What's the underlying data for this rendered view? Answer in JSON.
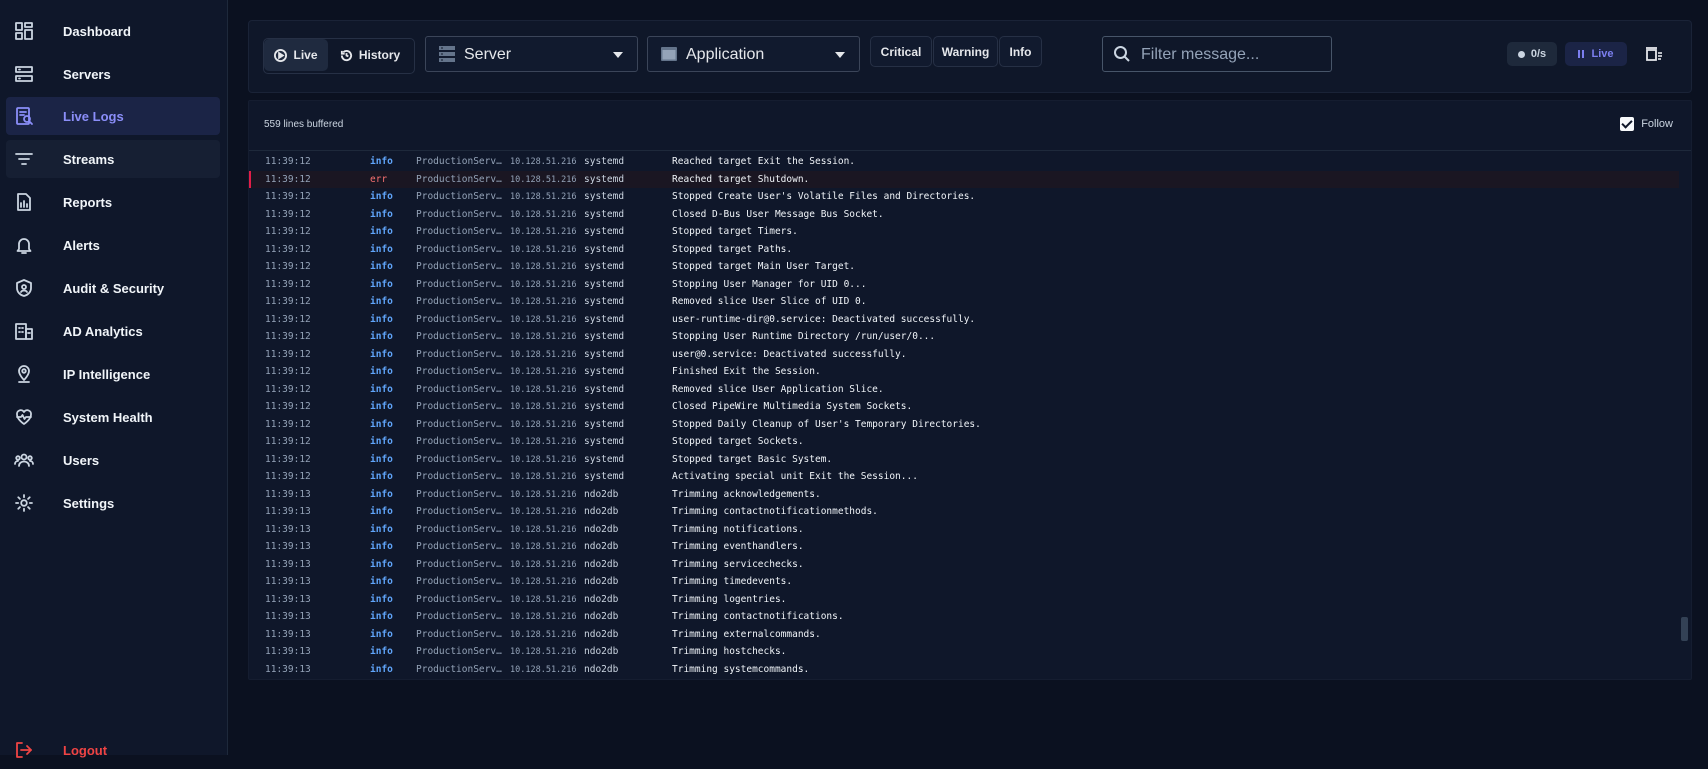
{
  "sidebar": {
    "items": [
      {
        "label": "Dashboard",
        "icon": "dashboard-icon"
      },
      {
        "label": "Servers",
        "icon": "server-icon"
      },
      {
        "label": "Live Logs",
        "icon": "live-logs-icon"
      },
      {
        "label": "Streams",
        "icon": "streams-icon"
      },
      {
        "label": "Reports",
        "icon": "reports-icon"
      },
      {
        "label": "Alerts",
        "icon": "bell-icon"
      },
      {
        "label": "Audit & Security",
        "icon": "shield-icon"
      },
      {
        "label": "AD Analytics",
        "icon": "building-icon"
      },
      {
        "label": "IP Intelligence",
        "icon": "map-pin-icon"
      },
      {
        "label": "System Health",
        "icon": "heartbeat-icon"
      },
      {
        "label": "Users",
        "icon": "users-icon"
      },
      {
        "label": "Settings",
        "icon": "gear-icon"
      }
    ],
    "active": "Live Logs",
    "logout_label": "Logout"
  },
  "toolbar": {
    "live_label": "Live",
    "history_label": "History",
    "server_select": "Server",
    "application_select": "Application",
    "filters": [
      "Critical",
      "Warning",
      "Info"
    ],
    "search_placeholder": "Filter message...",
    "rate_label": "0/s",
    "live_badge": "Live"
  },
  "log_panel": {
    "buffered_label": "559 lines buffered",
    "follow_label": "Follow",
    "follow_checked": true
  },
  "colors": {
    "accent": "#8b8ef9",
    "info": "#60a5fa",
    "error": "#f87171"
  },
  "logs": [
    {
      "time": "11:39:12",
      "level": "info",
      "host": "ProductionServ…",
      "ip": "10.128.51.216",
      "app": "systemd",
      "message": "Reached target Exit the Session."
    },
    {
      "time": "11:39:12",
      "level": "err",
      "host": "ProductionServ…",
      "ip": "10.128.51.216",
      "app": "systemd",
      "message": "Reached target Shutdown."
    },
    {
      "time": "11:39:12",
      "level": "info",
      "host": "ProductionServ…",
      "ip": "10.128.51.216",
      "app": "systemd",
      "message": "Stopped Create User's Volatile Files and Directories."
    },
    {
      "time": "11:39:12",
      "level": "info",
      "host": "ProductionServ…",
      "ip": "10.128.51.216",
      "app": "systemd",
      "message": "Closed D-Bus User Message Bus Socket."
    },
    {
      "time": "11:39:12",
      "level": "info",
      "host": "ProductionServ…",
      "ip": "10.128.51.216",
      "app": "systemd",
      "message": "Stopped target Timers."
    },
    {
      "time": "11:39:12",
      "level": "info",
      "host": "ProductionServ…",
      "ip": "10.128.51.216",
      "app": "systemd",
      "message": "Stopped target Paths."
    },
    {
      "time": "11:39:12",
      "level": "info",
      "host": "ProductionServ…",
      "ip": "10.128.51.216",
      "app": "systemd",
      "message": "Stopped target Main User Target."
    },
    {
      "time": "11:39:12",
      "level": "info",
      "host": "ProductionServ…",
      "ip": "10.128.51.216",
      "app": "systemd",
      "message": "Stopping User Manager for UID 0..."
    },
    {
      "time": "11:39:12",
      "level": "info",
      "host": "ProductionServ…",
      "ip": "10.128.51.216",
      "app": "systemd",
      "message": "Removed slice User Slice of UID 0."
    },
    {
      "time": "11:39:12",
      "level": "info",
      "host": "ProductionServ…",
      "ip": "10.128.51.216",
      "app": "systemd",
      "message": "user-runtime-dir@0.service: Deactivated successfully."
    },
    {
      "time": "11:39:12",
      "level": "info",
      "host": "ProductionServ…",
      "ip": "10.128.51.216",
      "app": "systemd",
      "message": "Stopping User Runtime Directory /run/user/0..."
    },
    {
      "time": "11:39:12",
      "level": "info",
      "host": "ProductionServ…",
      "ip": "10.128.51.216",
      "app": "systemd",
      "message": "user@0.service: Deactivated successfully."
    },
    {
      "time": "11:39:12",
      "level": "info",
      "host": "ProductionServ…",
      "ip": "10.128.51.216",
      "app": "systemd",
      "message": "Finished Exit the Session."
    },
    {
      "time": "11:39:12",
      "level": "info",
      "host": "ProductionServ…",
      "ip": "10.128.51.216",
      "app": "systemd",
      "message": "Removed slice User Application Slice."
    },
    {
      "time": "11:39:12",
      "level": "info",
      "host": "ProductionServ…",
      "ip": "10.128.51.216",
      "app": "systemd",
      "message": "Closed PipeWire Multimedia System Sockets."
    },
    {
      "time": "11:39:12",
      "level": "info",
      "host": "ProductionServ…",
      "ip": "10.128.51.216",
      "app": "systemd",
      "message": "Stopped Daily Cleanup of User's Temporary Directories."
    },
    {
      "time": "11:39:12",
      "level": "info",
      "host": "ProductionServ…",
      "ip": "10.128.51.216",
      "app": "systemd",
      "message": "Stopped target Sockets."
    },
    {
      "time": "11:39:12",
      "level": "info",
      "host": "ProductionServ…",
      "ip": "10.128.51.216",
      "app": "systemd",
      "message": "Stopped target Basic System."
    },
    {
      "time": "11:39:12",
      "level": "info",
      "host": "ProductionServ…",
      "ip": "10.128.51.216",
      "app": "systemd",
      "message": "Activating special unit Exit the Session..."
    },
    {
      "time": "11:39:13",
      "level": "info",
      "host": "ProductionServ…",
      "ip": "10.128.51.216",
      "app": "ndo2db",
      "message": "Trimming acknowledgements."
    },
    {
      "time": "11:39:13",
      "level": "info",
      "host": "ProductionServ…",
      "ip": "10.128.51.216",
      "app": "ndo2db",
      "message": "Trimming contactnotificationmethods."
    },
    {
      "time": "11:39:13",
      "level": "info",
      "host": "ProductionServ…",
      "ip": "10.128.51.216",
      "app": "ndo2db",
      "message": "Trimming notifications."
    },
    {
      "time": "11:39:13",
      "level": "info",
      "host": "ProductionServ…",
      "ip": "10.128.51.216",
      "app": "ndo2db",
      "message": "Trimming eventhandlers."
    },
    {
      "time": "11:39:13",
      "level": "info",
      "host": "ProductionServ…",
      "ip": "10.128.51.216",
      "app": "ndo2db",
      "message": "Trimming servicechecks."
    },
    {
      "time": "11:39:13",
      "level": "info",
      "host": "ProductionServ…",
      "ip": "10.128.51.216",
      "app": "ndo2db",
      "message": "Trimming timedevents."
    },
    {
      "time": "11:39:13",
      "level": "info",
      "host": "ProductionServ…",
      "ip": "10.128.51.216",
      "app": "ndo2db",
      "message": "Trimming logentries."
    },
    {
      "time": "11:39:13",
      "level": "info",
      "host": "ProductionServ…",
      "ip": "10.128.51.216",
      "app": "ndo2db",
      "message": "Trimming contactnotifications."
    },
    {
      "time": "11:39:13",
      "level": "info",
      "host": "ProductionServ…",
      "ip": "10.128.51.216",
      "app": "ndo2db",
      "message": "Trimming externalcommands."
    },
    {
      "time": "11:39:13",
      "level": "info",
      "host": "ProductionServ…",
      "ip": "10.128.51.216",
      "app": "ndo2db",
      "message": "Trimming hostchecks."
    },
    {
      "time": "11:39:13",
      "level": "info",
      "host": "ProductionServ…",
      "ip": "10.128.51.216",
      "app": "ndo2db",
      "message": "Trimming systemcommands."
    }
  ]
}
